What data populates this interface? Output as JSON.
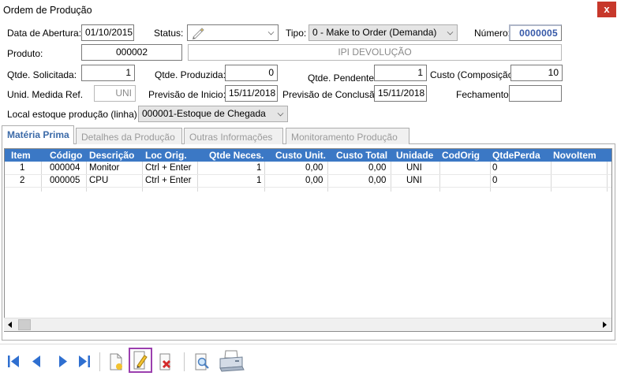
{
  "window": {
    "title": "Ordem de Produção",
    "close_label": "x"
  },
  "form": {
    "data_abertura_label": "Data de Abertura:",
    "data_abertura": "01/10/2015",
    "status_label": "Status:",
    "tipo_label": "Tipo:",
    "tipo_value": "0 - Make to Order (Demanda)",
    "numero_label": "Número:",
    "numero": "0000005",
    "produto_label": "Produto:",
    "produto_codigo": "000002",
    "produto_descricao": "IPI DEVOLUÇÃO",
    "qtde_solicitada_label": "Qtde. Solicitada:",
    "qtde_solicitada": "1",
    "qtde_produzida_label": "Qtde. Produzida:",
    "qtde_produzida": "0",
    "qtde_pendente_label": "Qtde. Pendente:",
    "qtde_pendente": "1",
    "custo_label": "Custo (Composição):",
    "custo": "10",
    "unid_medida_label": "Unid. Medida Ref.",
    "unid_medida": "UNI",
    "previsao_inicio_label": "Previsão de Inicio:",
    "previsao_inicio": "15/11/2018",
    "previsao_conclusao_label": "Previsão de Conclusão:",
    "previsao_conclusao": "15/11/2018",
    "fechamento_label": "Fechamento:",
    "fechamento": "",
    "local_estoque_label": "Local estoque produção (linha) :",
    "local_estoque_value": "000001-Estoque de Chegada"
  },
  "tabs": [
    {
      "label": "Matéria Prima",
      "active": true
    },
    {
      "label": "Detalhes da Produção",
      "active": false
    },
    {
      "label": "Outras Informações",
      "active": false
    },
    {
      "label": "Monitoramento Produção",
      "active": false
    }
  ],
  "grid": {
    "columns": [
      "Item",
      "Código",
      "Descrição",
      "Loc Orig.",
      "Qtde Neces.",
      "Custo Unit.",
      "Custo Total",
      "Unidade",
      "CodOrig",
      "QtdePerda",
      "NovoItem"
    ],
    "rows": [
      [
        "1",
        "000004",
        "Monitor",
        "Ctrl + Enter",
        "1",
        "0,00",
        "0,00",
        "UNI",
        "",
        "0",
        ""
      ],
      [
        "2",
        "000005",
        "CPU",
        "Ctrl + Enter",
        "1",
        "0,00",
        "0,00",
        "UNI",
        "",
        "0",
        ""
      ]
    ]
  },
  "toolbar": {
    "buttons": [
      "first-record",
      "previous-record",
      "next-record",
      "last-record",
      "new-record",
      "edit-record",
      "delete-record",
      "search-record",
      "print-record"
    ]
  },
  "colors": {
    "grid_header": "#3b78c5",
    "active_tab_text": "#3b6aa8",
    "numero_text": "#3558a8",
    "toolbar_arrow": "#2f6fd0",
    "highlight": "#9b3fae"
  }
}
